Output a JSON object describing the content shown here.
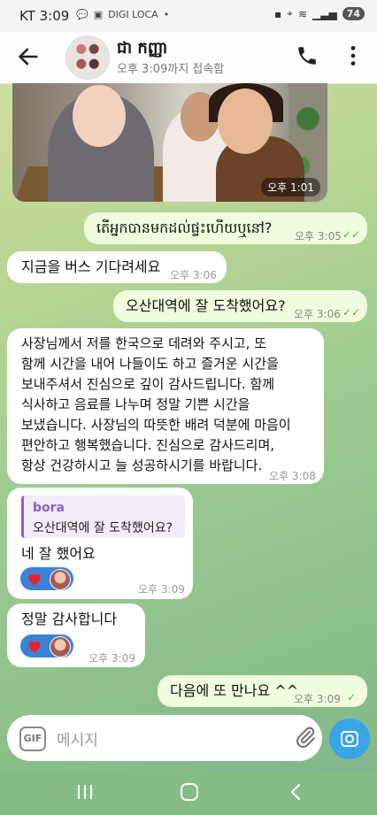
{
  "status_bar": {
    "time": "3:09",
    "carrier": "KT",
    "battery": "74",
    "icons_left": [
      "chat-icon",
      "app-icon",
      "DIGI LOCA",
      "•"
    ]
  },
  "header": {
    "name": "ជា កញ្ញា",
    "status": "오후 3:09까지 접속함"
  },
  "photo": {
    "time": "오후 1:01"
  },
  "messages": [
    {
      "side": "out",
      "text": "តើអ្នកបានមកដល់ផ្ទះហើយឬនៅ?",
      "time": "오후 3:05",
      "read": "✓✓"
    },
    {
      "side": "in",
      "text": "지금을 버스 기다려세요",
      "time": "오후 3:06"
    },
    {
      "side": "out",
      "text": "오산대역에 잘 도착했어요?",
      "time": "오후 3:06",
      "read": "✓✓"
    },
    {
      "side": "in",
      "lines": [
        "사장님께서 저를 한국으로 데려와 주시고, 또",
        "함께 시간을 내어 나들이도 하고 즐거운 시간을",
        "보내주셔서 진심으로 깊이 감사드립니다. 함께",
        "식사하고 음료를 나누며 정말 기쁜 시간을",
        "보냈습니다. 사장님의 따뜻한 배려 덕분에 마음이",
        "편안하고 행복했습니다. 진심으로 감사드리며,",
        "항상 건강하시고 늘 성공하시기를 바랍니다."
      ],
      "time": "오후 3:08"
    },
    {
      "side": "in",
      "reply_name": "bora",
      "reply_text": "오산대역에 잘 도착했어요?",
      "text": "네 잘 했어요",
      "time": "오후 3:09"
    },
    {
      "side": "in",
      "text": "정말 감사합니다",
      "time": "오후 3:09"
    },
    {
      "side": "out",
      "text": "다음에 또 만나요 ^^",
      "time": "오후 3:09",
      "read": "✓"
    }
  ],
  "input": {
    "placeholder": "메시지",
    "gif_label": "GIF"
  },
  "colors": {
    "out_bubble": "#effdde",
    "in_bubble": "#ffffff",
    "accent": "#39a4e6",
    "reaction": "#3b82d6",
    "check": "#4fae4e"
  }
}
